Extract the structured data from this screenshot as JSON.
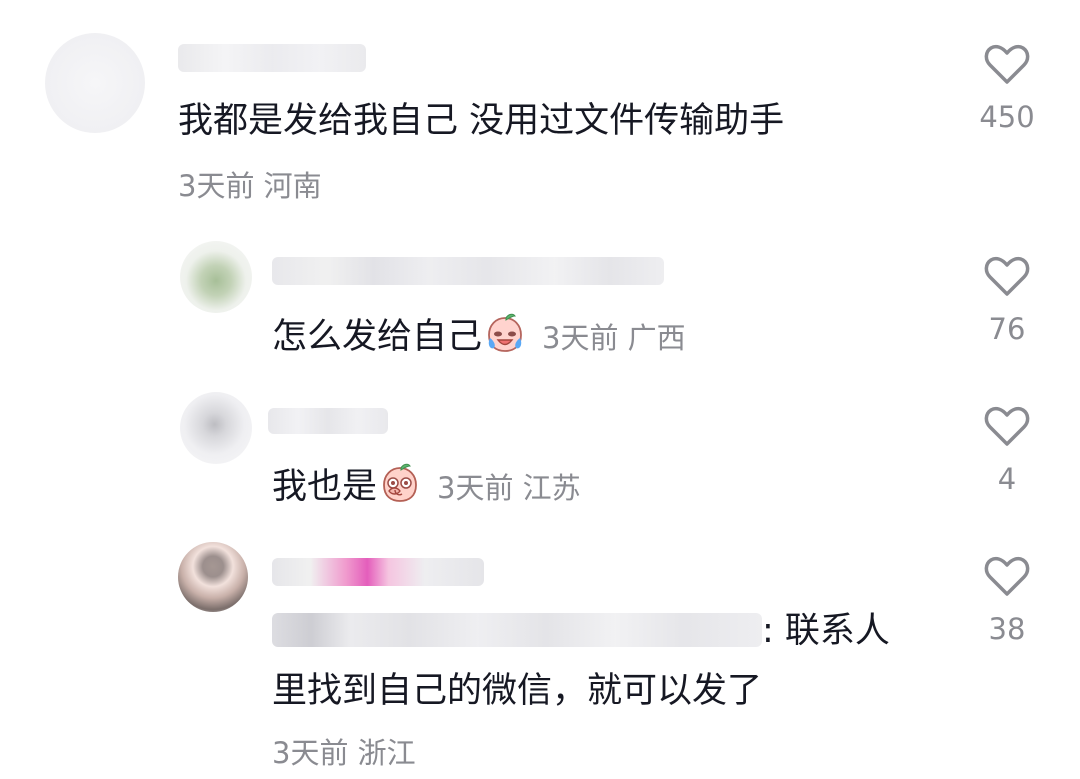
{
  "comments": [
    {
      "text": "我都是发给我自己 没用过文件传输助手",
      "meta": "3天前 河南",
      "likes": "450"
    },
    {
      "text": "怎么发给自己",
      "meta": "3天前 广西",
      "likes": "76",
      "emoji_icon": "crying-peach-emoji"
    },
    {
      "text": "我也是",
      "meta": "3天前 江苏",
      "likes": "4",
      "emoji_icon": "peach-covering-mouth-emoji"
    },
    {
      "reply_suffix": ": 联系人",
      "text_line2": "里找到自己的微信，就可以发了",
      "meta": "3天前 浙江",
      "likes": "38"
    }
  ],
  "icons": {
    "like": "heart-icon"
  },
  "colors": {
    "text": "#161823",
    "meta": "#8a8b91",
    "heart": "#8a8b91"
  }
}
